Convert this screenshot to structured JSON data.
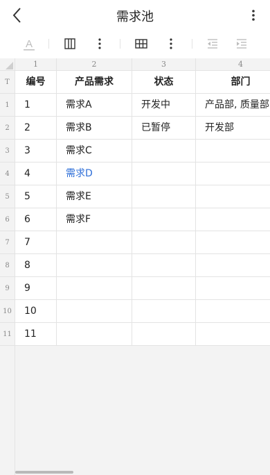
{
  "header": {
    "title": "需求池"
  },
  "toolbar": {
    "icons": [
      "text-color-icon",
      "column-icon",
      "more-vertical-icon",
      "table-icon",
      "more-vertical-icon",
      "outdent-icon",
      "indent-icon"
    ]
  },
  "grid": {
    "corner_label": "",
    "col_headers": [
      "1",
      "2",
      "3",
      "4"
    ],
    "row_headers": [
      "T",
      "1",
      "2",
      "3",
      "4",
      "5",
      "6",
      "7",
      "8",
      "9",
      "10",
      "11"
    ],
    "header_row": [
      "编号",
      "产品需求",
      "状态",
      "部门"
    ],
    "rows": [
      [
        "1",
        "需求A",
        "开发中",
        "产品部, 质量部"
      ],
      [
        "2",
        "需求B",
        "已暂停",
        "开发部"
      ],
      [
        "3",
        "需求C",
        "",
        ""
      ],
      [
        "4",
        "需求D",
        "",
        ""
      ],
      [
        "5",
        "需求E",
        "",
        ""
      ],
      [
        "6",
        "需求F",
        "",
        ""
      ],
      [
        "7",
        "",
        "",
        ""
      ],
      [
        "8",
        "",
        "",
        ""
      ],
      [
        "9",
        "",
        "",
        ""
      ],
      [
        "10",
        "",
        "",
        ""
      ],
      [
        "11",
        "",
        "",
        ""
      ]
    ],
    "link_color": "#2f6fd8"
  }
}
